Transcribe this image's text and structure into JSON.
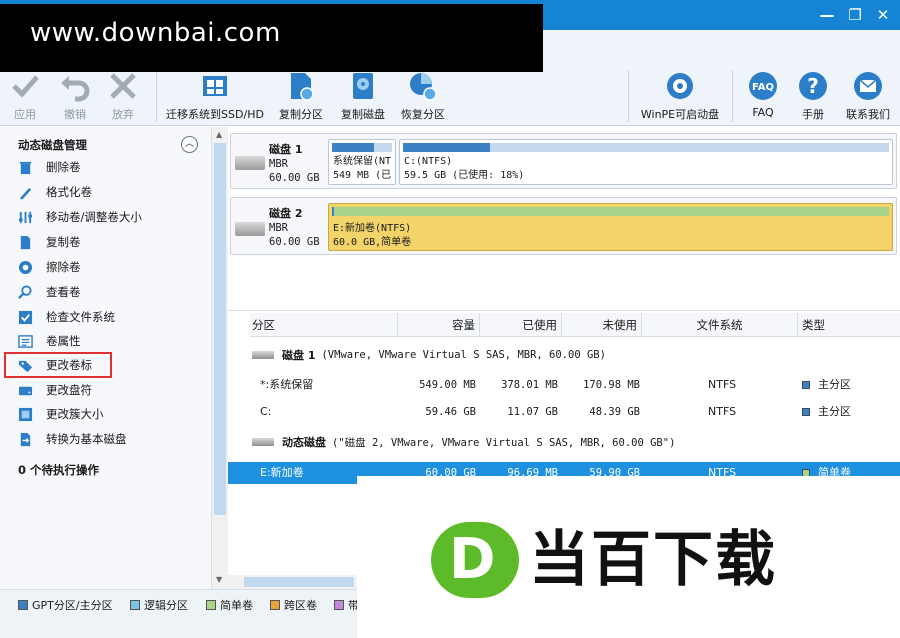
{
  "watermark": {
    "url": "www.downbai.com",
    "logo_letter": "D",
    "logo_text": "当百下载"
  },
  "window": {
    "min": "—",
    "restore": "❐",
    "close": "✕"
  },
  "toolbar": {
    "apply": "应用",
    "undo": "撤销",
    "discard": "放弃",
    "migrate": "迁移系统到SSD/HD",
    "copy_partition": "复制分区",
    "copy_disk": "复制磁盘",
    "recover": "恢复分区",
    "winpe": "WinPE可启动盘",
    "faq": "FAQ",
    "manual": "手册",
    "contact": "联系我们"
  },
  "sidebar": {
    "heading": "动态磁盘管理",
    "items": [
      {
        "label": "删除卷",
        "icon": "trash-icon"
      },
      {
        "label": "格式化卷",
        "icon": "pen-icon"
      },
      {
        "label": "移动卷/调整卷大小",
        "icon": "resize-icon"
      },
      {
        "label": "复制卷",
        "icon": "copy-icon"
      },
      {
        "label": "擦除卷",
        "icon": "wipe-icon"
      },
      {
        "label": "查看卷",
        "icon": "magnifier-icon"
      },
      {
        "label": "检查文件系统",
        "icon": "check-icon"
      },
      {
        "label": "卷属性",
        "icon": "properties-icon"
      },
      {
        "label": "更改卷标",
        "icon": "tag-icon"
      },
      {
        "label": "更改盘符",
        "icon": "drive-letter-icon"
      },
      {
        "label": "更改簇大小",
        "icon": "cluster-icon"
      },
      {
        "label": "转换为基本磁盘",
        "icon": "convert-icon"
      }
    ],
    "pending": "0 个待执行操作"
  },
  "disks": [
    {
      "name": "磁盘 1",
      "type": "MBR",
      "size": "60.00 GB",
      "partitions": [
        {
          "label": "系统保留(NT",
          "detail": "549 MB (已",
          "used": 0.69
        },
        {
          "label": "C:(NTFS)",
          "detail": "59.5 GB (已使用: 18%)",
          "used": 0.18
        }
      ]
    },
    {
      "name": "磁盘 2",
      "type": "MBR",
      "size": "60.00 GB",
      "partitions": [
        {
          "label": "E:新加卷(NTFS)",
          "detail": "60.0 GB,简单卷",
          "used": 0.002
        }
      ]
    }
  ],
  "table": {
    "headers": [
      "分区",
      "容量",
      "已使用",
      "未使用",
      "文件系统",
      "类型"
    ],
    "groups": [
      {
        "name": "磁盘 1",
        "desc": "(VMware, VMware Virtual S SAS, MBR, 60.00 GB)",
        "rows": [
          {
            "partition": "*:系统保留",
            "capacity": "549.00 MB",
            "used": "378.01 MB",
            "free": "170.98 MB",
            "fs": "NTFS",
            "type": "主分区"
          },
          {
            "partition": "C:",
            "capacity": "59.46 GB",
            "used": "11.07 GB",
            "free": "48.39 GB",
            "fs": "NTFS",
            "type": "主分区"
          }
        ]
      },
      {
        "name": "动态磁盘",
        "desc": "(\"磁盘 2, VMware, VMware Virtual S SAS, MBR, 60.00 GB\")",
        "rows": [
          {
            "partition": "E:新加卷",
            "capacity": "60.00 GB",
            "used": "96.69 MB",
            "free": "59.90 GB",
            "fs": "NTFS",
            "type": "简单卷"
          }
        ]
      }
    ]
  },
  "legend": [
    {
      "label": "GPT分区/主分区",
      "color": "#3b82c4"
    },
    {
      "label": "逻辑分区",
      "color": "#7fc4e8"
    },
    {
      "label": "简单卷",
      "color": "#a8d48a"
    },
    {
      "label": "跨区卷",
      "color": "#e7a23b"
    },
    {
      "label": "带",
      "color": "#c38ad8"
    }
  ],
  "colors": {
    "titlebar": "#1584d5",
    "selection": "#1e90e0",
    "simple_volume": "#f2d46b"
  }
}
